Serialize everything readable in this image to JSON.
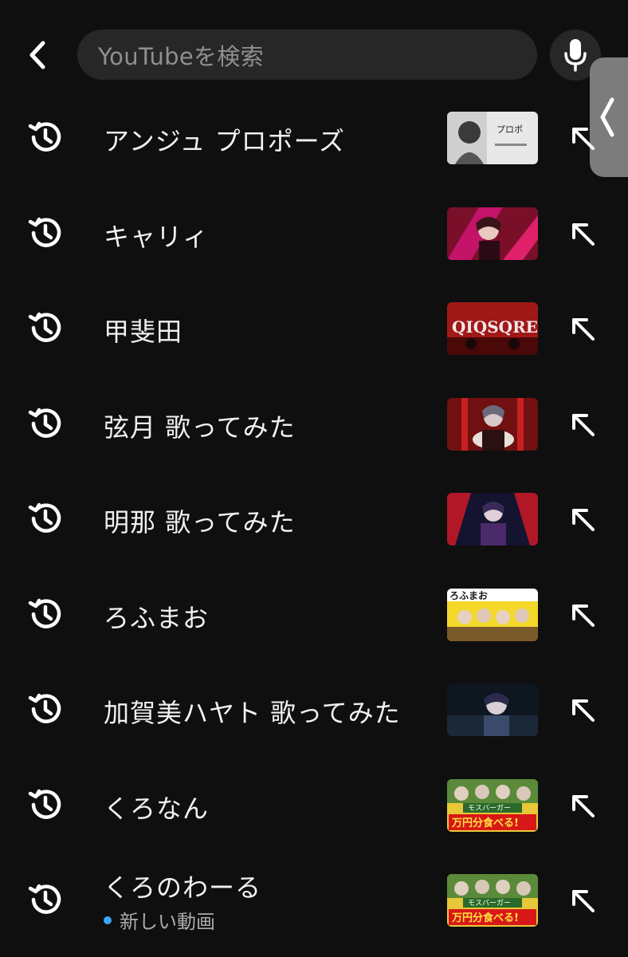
{
  "header": {
    "search_placeholder": "YouTubeを検索",
    "back_icon": "chevron-left-icon",
    "mic_icon": "microphone-icon",
    "side_handle_icon": "chevron-left-icon"
  },
  "history": [
    {
      "query": "アンジュ プロポーズ",
      "subtitle": "",
      "thumb_theme": "gray-sketch"
    },
    {
      "query": "キャリィ",
      "subtitle": "",
      "thumb_theme": "red-magenta"
    },
    {
      "query": "甲斐田",
      "subtitle": "",
      "thumb_theme": "red-title"
    },
    {
      "query": "弦月 歌ってみた",
      "subtitle": "",
      "thumb_theme": "dark-red"
    },
    {
      "query": "明那 歌ってみた",
      "subtitle": "",
      "thumb_theme": "navy-red"
    },
    {
      "query": "ろふまお",
      "subtitle": "",
      "thumb_theme": "yellow-group"
    },
    {
      "query": "加賀美ハヤト 歌ってみた",
      "subtitle": "",
      "thumb_theme": "dark-blue"
    },
    {
      "query": "くろなん",
      "subtitle": "",
      "thumb_theme": "green-gold"
    },
    {
      "query": "くろのわーる",
      "subtitle": "新しい動画",
      "thumb_theme": "green-gold"
    }
  ],
  "colors": {
    "background": "#0f0f0f",
    "search_bg": "#272727",
    "text": "#f1f1f1",
    "subtext": "#aaaaaa",
    "new_dot": "#3ea6ff"
  }
}
